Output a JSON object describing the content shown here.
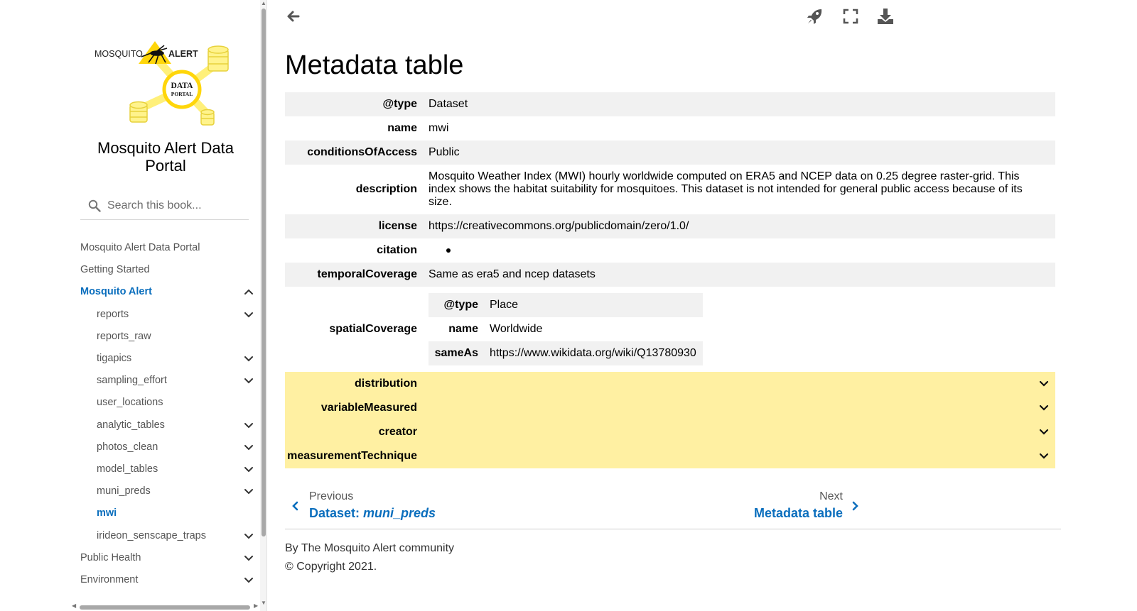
{
  "sidebar": {
    "logo": {
      "word_left": "MOSQUITO",
      "word_right": "ALERT",
      "badge_top": "DATA",
      "badge_bottom": "PORTAL"
    },
    "title": "Mosquito Alert Data Portal",
    "search_placeholder": "Search this book...",
    "nav": [
      {
        "label": "Mosquito Alert Data Portal",
        "level": 0,
        "chevron": "none",
        "active": false
      },
      {
        "label": "Getting Started",
        "level": 0,
        "chevron": "none",
        "active": false
      },
      {
        "label": "Mosquito Alert",
        "level": 0,
        "chevron": "up",
        "active": true
      },
      {
        "label": "reports",
        "level": 1,
        "chevron": "down",
        "active": false
      },
      {
        "label": "reports_raw",
        "level": 1,
        "chevron": "none",
        "active": false
      },
      {
        "label": "tigapics",
        "level": 1,
        "chevron": "down",
        "active": false
      },
      {
        "label": "sampling_effort",
        "level": 1,
        "chevron": "down",
        "active": false
      },
      {
        "label": "user_locations",
        "level": 1,
        "chevron": "none",
        "active": false
      },
      {
        "label": "analytic_tables",
        "level": 1,
        "chevron": "down",
        "active": false
      },
      {
        "label": "photos_clean",
        "level": 1,
        "chevron": "down",
        "active": false
      },
      {
        "label": "model_tables",
        "level": 1,
        "chevron": "down",
        "active": false
      },
      {
        "label": "muni_preds",
        "level": 1,
        "chevron": "down",
        "active": false
      },
      {
        "label": "mwi",
        "level": 1,
        "chevron": "none",
        "active": true
      },
      {
        "label": "irideon_senscape_traps",
        "level": 1,
        "chevron": "down",
        "active": false
      },
      {
        "label": "Public Health",
        "level": 0,
        "chevron": "down",
        "active": false
      },
      {
        "label": "Environment",
        "level": 0,
        "chevron": "down",
        "active": false
      }
    ]
  },
  "toolbar": {
    "back": "arrow-left-icon",
    "launch": "rocket-icon",
    "fullscreen": "expand-icon",
    "download": "download-icon"
  },
  "page_title": "Metadata table",
  "metadata": {
    "type_key": "@type",
    "type_value": "Dataset",
    "name_key": "name",
    "name_value": "mwi",
    "access_key": "conditionsOfAccess",
    "access_value": "Public",
    "description_key": "description",
    "description_value": "Mosquito Weather Index (MWI) hourly worldwide computed on ERA5 and NCEP data on 0.25 degree raster-grid. This index shows the habitat suitability for mosquitoes. This dataset is not intended for general public access because of its size.",
    "license_key": "license",
    "license_value": "https://creativecommons.org/publicdomain/zero/1.0/",
    "citation_key": "citation",
    "temporal_key": "temporalCoverage",
    "temporal_value": "Same as era5 and ncep datasets",
    "spatial_key": "spatialCoverage",
    "spatial": {
      "type_key": "@type",
      "type_value": "Place",
      "name_key": "name",
      "name_value": "Worldwide",
      "sameas_key": "sameAs",
      "sameas_value": "https://www.wikidata.org/wiki/Q13780930"
    },
    "collapsed": [
      "distribution",
      "variableMeasured",
      "creator",
      "measurementTechnique"
    ]
  },
  "prev": {
    "label": "Previous",
    "title_prefix": "Dataset: ",
    "title_em": "muni_preds"
  },
  "next": {
    "label": "Next",
    "title": "Metadata table"
  },
  "footer": {
    "author": "By The Mosquito Alert community",
    "copyright": "© Copyright 2021."
  },
  "colors": {
    "link": "#0a6ebd",
    "collapsed_row": "#fff0a2",
    "stripe": "#f1f1f1"
  }
}
